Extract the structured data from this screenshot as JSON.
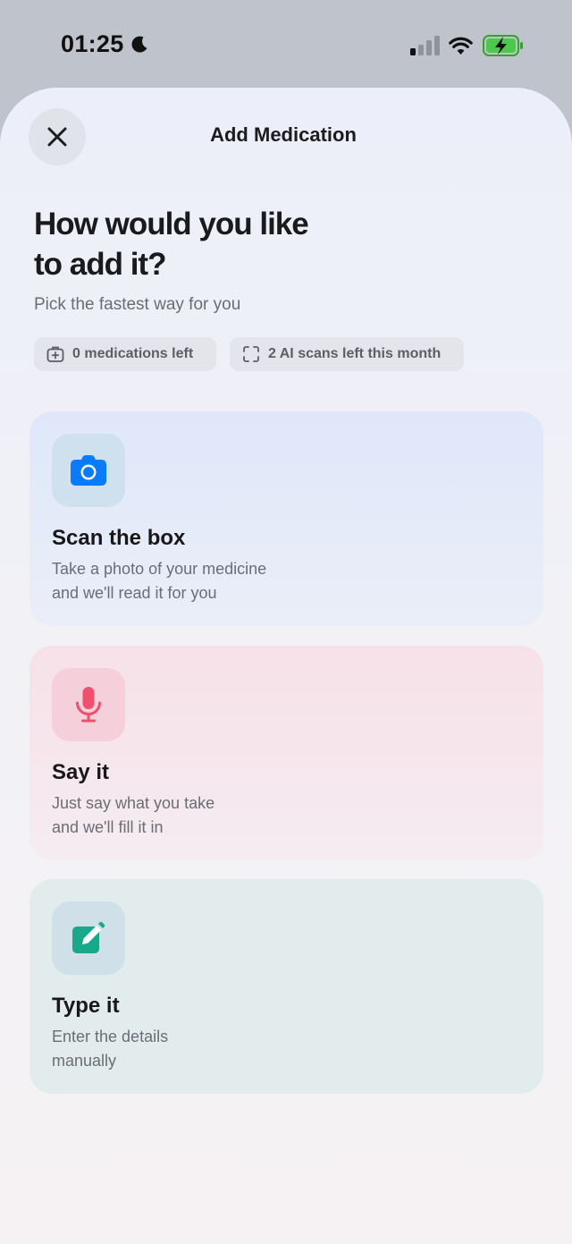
{
  "status_bar": {
    "time": "01:25",
    "icons": [
      "moon-icon",
      "cellular-signal-icon",
      "wifi-icon",
      "battery-charging-icon"
    ]
  },
  "sheet": {
    "title": "Add Medication",
    "close_icon": "close-icon",
    "headline_line1": "How would you like",
    "headline_line2": "to add it?",
    "subtitle": "Pick the fastest way for you",
    "chips": [
      {
        "icon": "medkit-icon",
        "label": "0 medications left"
      },
      {
        "icon": "scan-frame-icon",
        "label": "2 AI scans left this month"
      }
    ],
    "options": [
      {
        "icon": "camera-icon",
        "title": "Scan the box",
        "desc_line1": "Take a photo of your medicine",
        "desc_line2": "and we'll read it for you"
      },
      {
        "icon": "microphone-icon",
        "title": "Say it",
        "desc_line1": "Just say what you take",
        "desc_line2": "and we'll fill it in"
      },
      {
        "icon": "edit-pencil-icon",
        "title": "Type it",
        "desc_line1": "Enter the details",
        "desc_line2": "manually"
      }
    ]
  },
  "colors": {
    "camera": "#0a7aff",
    "microphone": "#f0506e",
    "edit": "#17a98a"
  }
}
